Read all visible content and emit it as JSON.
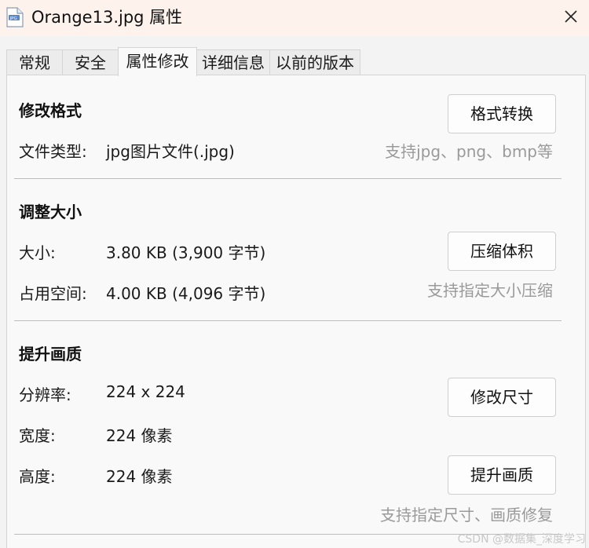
{
  "window": {
    "title": "Orange13.jpg 属性",
    "icon": "jpg-file-icon",
    "close_icon": "close-icon"
  },
  "tabs": [
    {
      "label": "常规",
      "active": false
    },
    {
      "label": "安全",
      "active": false
    },
    {
      "label": "属性修改",
      "active": true
    },
    {
      "label": "详细信息",
      "active": false
    },
    {
      "label": "以前的版本",
      "active": false
    }
  ],
  "format_section": {
    "heading": "修改格式",
    "button": "格式转换",
    "file_type_label": "文件类型:",
    "file_type_value": "jpg图片文件(.jpg)",
    "hint": "支持jpg、png、bmp等"
  },
  "size_section": {
    "heading": "调整大小",
    "size_label": "大小:",
    "size_value": "3.80 KB (3,900 字节)",
    "disk_label": "占用空间:",
    "disk_value": "4.00 KB (4,096 字节)",
    "button": "压缩体积",
    "hint": "支持指定大小压缩"
  },
  "quality_section": {
    "heading": "提升画质",
    "resolution_label": "分辨率:",
    "resolution_value": "224 x 224",
    "width_label": "宽度:",
    "width_value": "224 像素",
    "height_label": "高度:",
    "height_value": "224 像素",
    "resize_button": "修改尺寸",
    "enhance_button": "提升画质",
    "hint": "支持指定尺寸、画质修复"
  },
  "watermark": "CSDN @数据集_深度学习",
  "colors": {
    "titlebar_bg": "#fdf3ec",
    "panel_bg": "#f9f9f9",
    "hint_text": "#9a9a9a"
  }
}
